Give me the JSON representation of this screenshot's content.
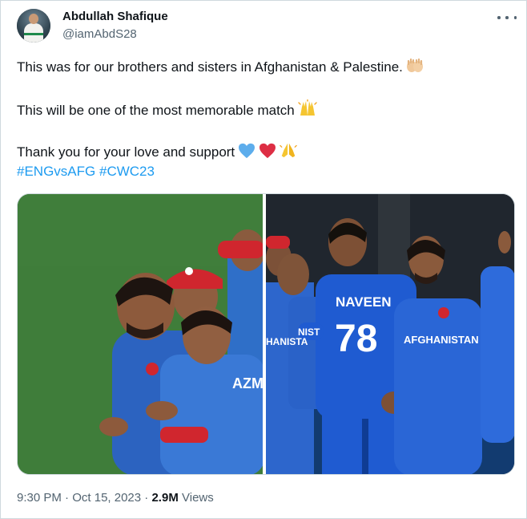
{
  "author": {
    "name": "Abdullah Shafique",
    "handle": "@iamAbdS28"
  },
  "tweet": {
    "line1": "This was for our brothers and sisters in Afghanistan & Palestine.",
    "line2": "This will be one of the most memorable match",
    "line3": "Thank you for your love and support",
    "hashtag1": "#ENGvsAFG",
    "hashtag2": "#CWC23",
    "emojis": [
      "palms-up-together-icon",
      "raising-hands-icon",
      "blue-heart-icon",
      "red-heart-icon",
      "folded-hands-icon"
    ]
  },
  "media": {
    "photos": [
      {
        "jersey_text": "AZMA"
      },
      {
        "jersey_name": "NAVEEN",
        "jersey_number": "78",
        "jersey_text": "AFGHANISTAN",
        "jersey_text_left": "HANISTA",
        "sleeve_text": "NIST"
      }
    ]
  },
  "footer": {
    "time": "9:30 PM",
    "separator": "·",
    "date": "Oct 15, 2023",
    "views_count": "2.9M",
    "views_label": "Views"
  },
  "colors": {
    "link": "#1d9bf0",
    "text": "#0f1419",
    "muted": "#536471",
    "jersey_blue": "#1f5bd1",
    "cap_red": "#d0262e"
  }
}
